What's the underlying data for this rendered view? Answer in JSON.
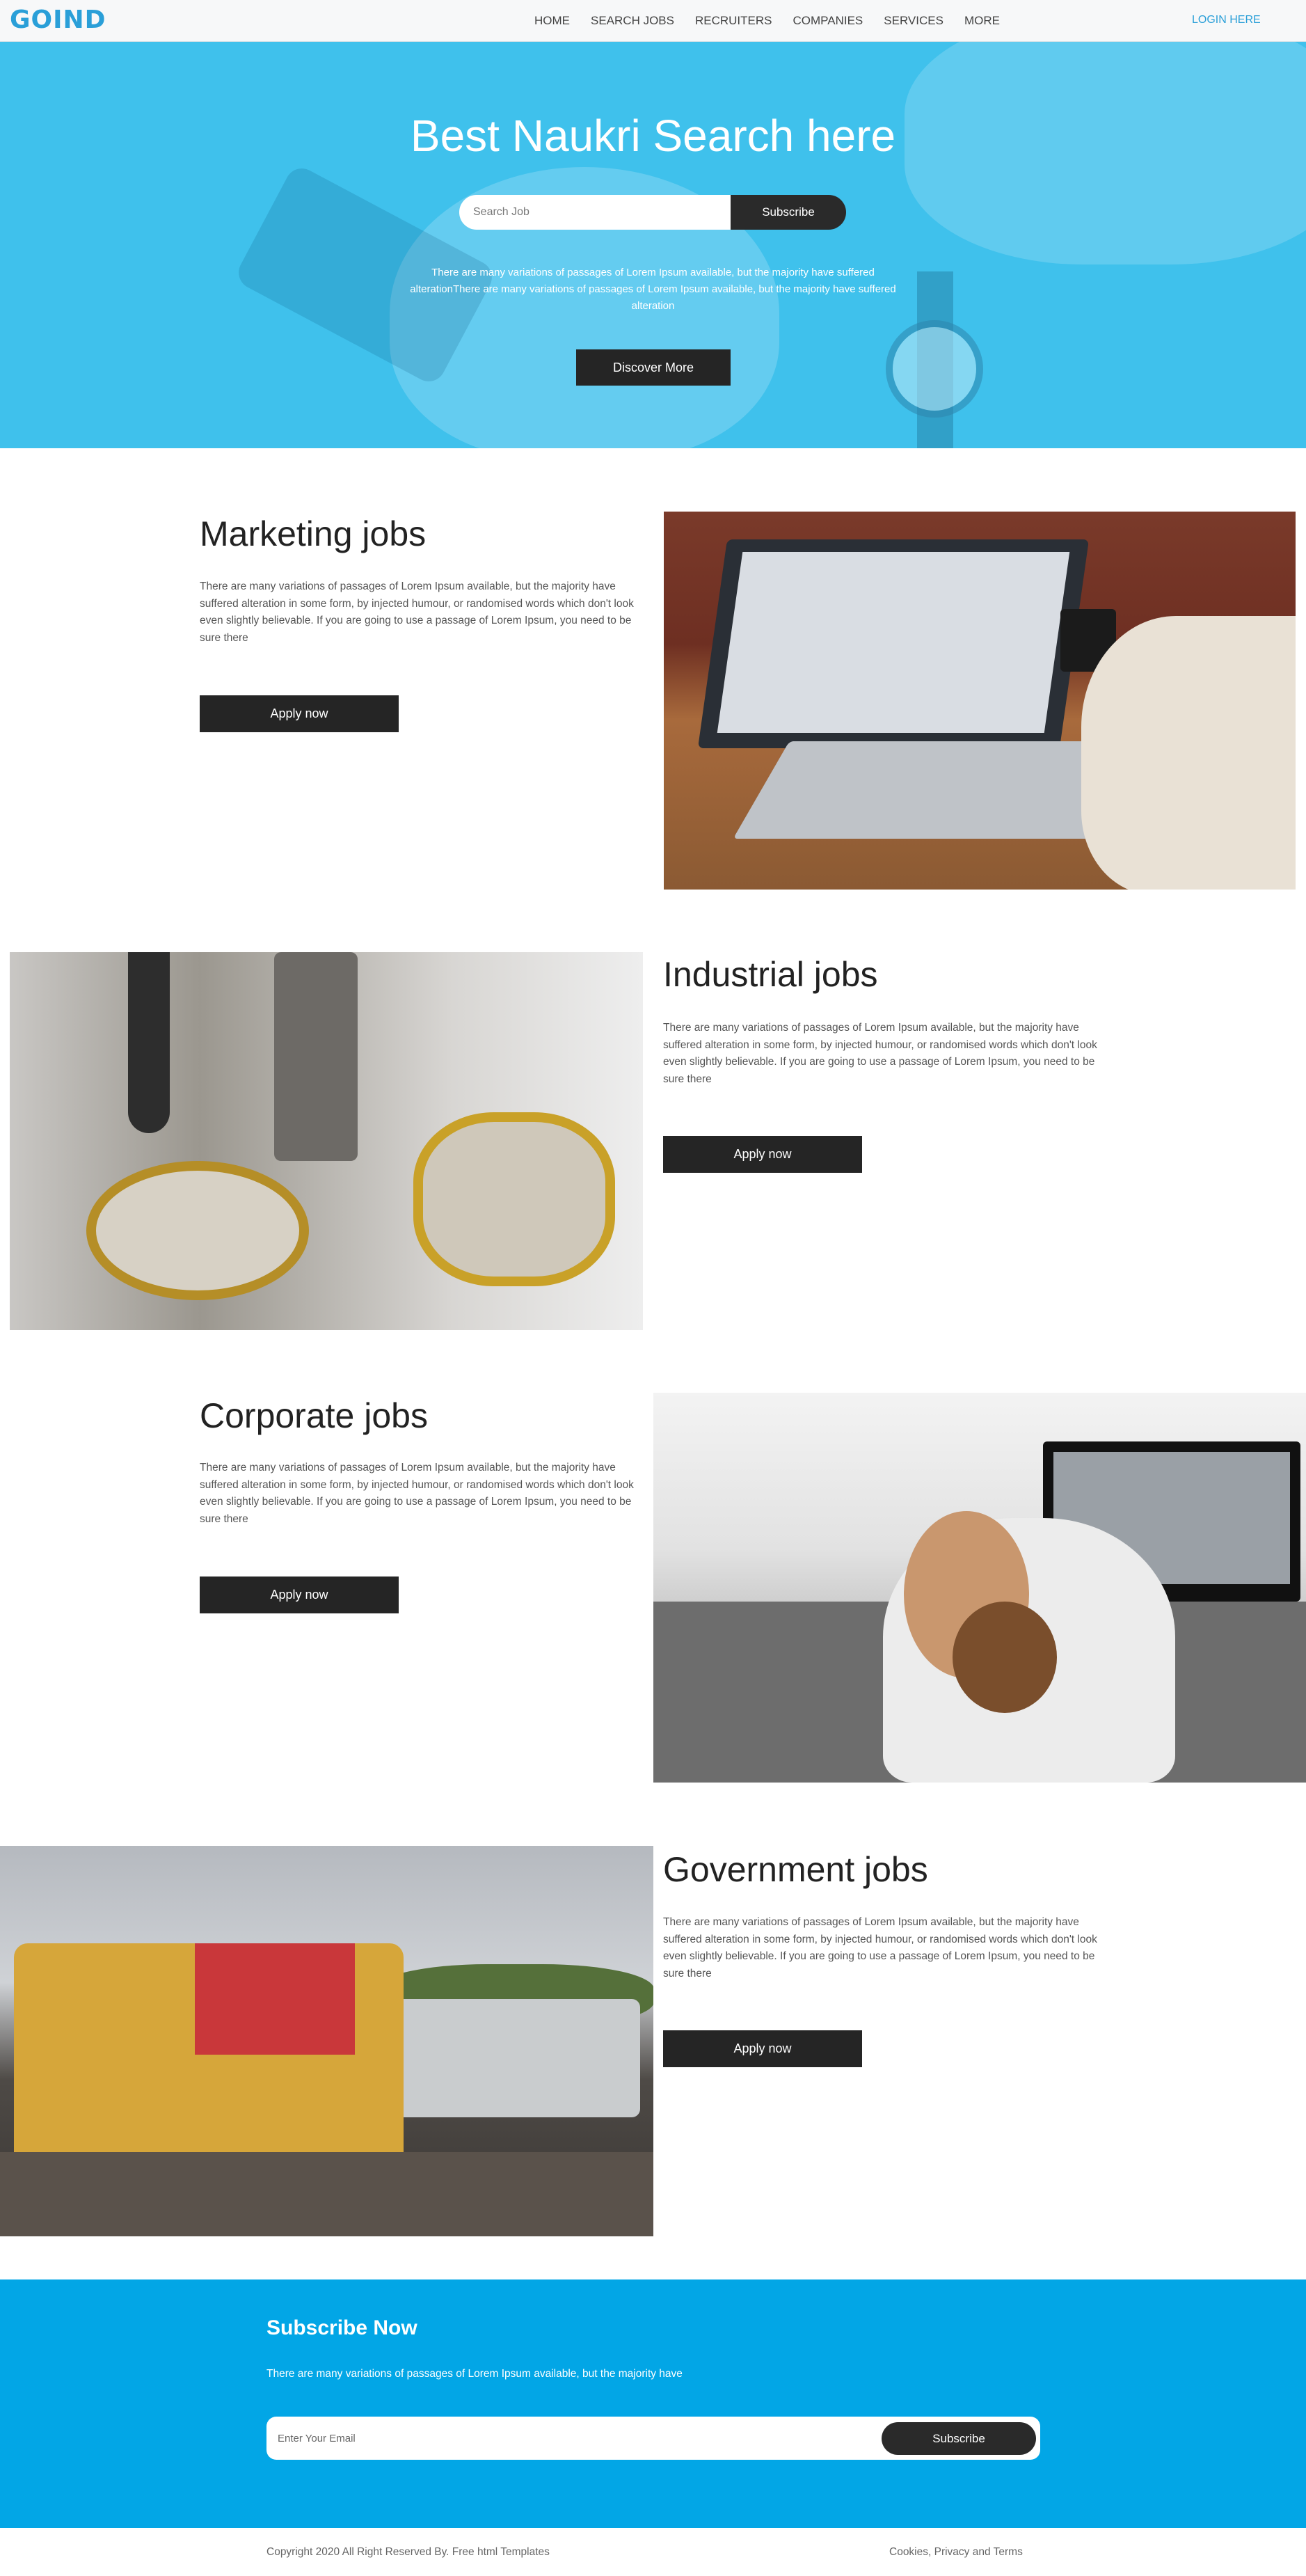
{
  "brand": {
    "logo": "GOIND"
  },
  "nav": {
    "links": [
      "HOME",
      "SEARCH JOBS",
      "RECRUITERS",
      "COMPANIES",
      "SERVICES",
      "MORE"
    ],
    "login": "LOGIN HERE"
  },
  "hero": {
    "title": "Best Naukri Search here",
    "search_placeholder": "Search Job",
    "subscribe_label": "Subscribe",
    "text": "There are many variations of passages of Lorem Ipsum available, but the majority have suffered alterationThere are many variations of passages of Lorem Ipsum available, but the majority have suffered alteration",
    "discover_label": "Discover More"
  },
  "jobs": [
    {
      "title": "Marketing jobs",
      "text": "There are many variations of passages of Lorem Ipsum available, but the majority have suffered alteration in some form, by injected humour, or randomised words which don't look even slightly believable. If you are going to use a passage of Lorem Ipsum, you need to be sure there",
      "apply_label": "Apply now"
    },
    {
      "title": "Industrial jobs",
      "text": "There are many variations of passages of Lorem Ipsum available, but the majority have suffered alteration in some form, by injected humour, or randomised words which don't look even slightly believable. If you are going to use a passage of Lorem Ipsum, you need to be sure there",
      "apply_label": "Apply now"
    },
    {
      "title": "Corporate jobs",
      "text": "There are many variations of passages of Lorem Ipsum available, but the majority have suffered alteration in some form, by injected humour, or randomised words which don't look even slightly believable. If you are going to use a passage of Lorem Ipsum, you need to be sure there",
      "apply_label": "Apply now"
    },
    {
      "title": "Government jobs",
      "text": "There are many variations of passages of Lorem Ipsum available, but the majority have suffered alteration in some form, by injected humour, or randomised words which don't look even slightly believable. If you are going to use a passage of Lorem Ipsum, you need to be sure there",
      "apply_label": "Apply now"
    }
  ],
  "subscribe": {
    "title": "Subscribe Now",
    "text": "There are many variations of passages of Lorem Ipsum available, but the majority have",
    "email_placeholder": "Enter Your Email",
    "button_label": "Subscribe"
  },
  "footer": {
    "copyright": "Copyright 2020 All Right Reserved By. Free html Templates",
    "links": "Cookies, Privacy and Terms"
  },
  "colors": {
    "brand_blue": "#2a9fd8",
    "hero_blue": "#3fc1ec",
    "subscribe_blue": "#02a6e6",
    "button_dark": "#252525"
  }
}
